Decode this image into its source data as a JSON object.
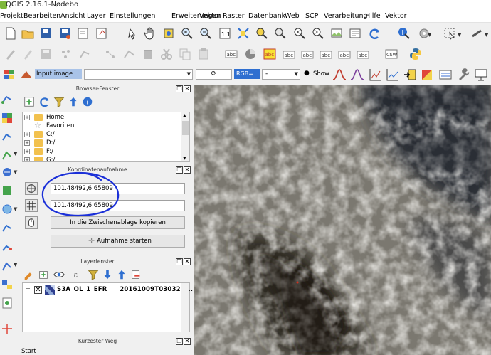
{
  "window": {
    "title": "QGIS 2.16.1-Nødebo"
  },
  "menu": [
    "Projekt",
    "Bearbeiten",
    "Ansicht",
    "Layer",
    "Einstellungen",
    "Erweiterungen",
    "Vektor",
    "Raster",
    "Datenbank",
    "Web",
    "SCP",
    "Verarbeitung",
    "Hilfe",
    "Vektor"
  ],
  "toolbar3": {
    "input_image_label": "Input image",
    "rgb_label": "RGB=",
    "rgb_value": "-",
    "show_label": "Show"
  },
  "browser": {
    "title": "Browser-Fenster",
    "items": [
      {
        "label": "Home",
        "kind": "folder"
      },
      {
        "label": "Favoriten",
        "kind": "favorites"
      },
      {
        "label": "C:/",
        "kind": "folder"
      },
      {
        "label": "D:/",
        "kind": "folder"
      },
      {
        "label": "F:/",
        "kind": "folder"
      },
      {
        "label": "G:/",
        "kind": "folder"
      }
    ]
  },
  "coords": {
    "title": "Koordinatenaufnahme",
    "value1": "101.48492,6.65809",
    "value2": "101.48492,6.65809",
    "copy_button": "In die Zwischenablage kopieren",
    "capture_button": "Aufnahme starten"
  },
  "layers": {
    "title": "Layerfenster",
    "items": [
      {
        "name": "S3A_OL_1_EFR____20161009T030329_...",
        "checked": true
      }
    ]
  },
  "shortest_path": {
    "title": "Kürzester Weg",
    "start_label": "Start"
  },
  "colors": {
    "annotation": "#1a2fd8",
    "selection": "#a9c3e8",
    "accent": "#2f6fd0"
  }
}
